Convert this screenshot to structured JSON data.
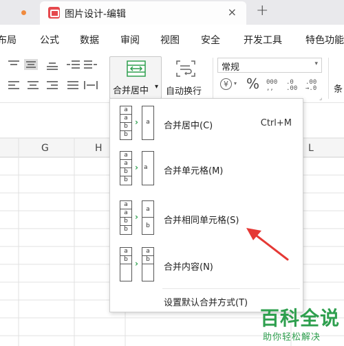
{
  "tabbar": {
    "doc_title": "图片设计-编辑",
    "close_glyph": "×",
    "new_tab_glyph": "+"
  },
  "menubar": {
    "items": [
      "布局",
      "公式",
      "数据",
      "审阅",
      "视图",
      "安全",
      "开发工具",
      "特色功能"
    ]
  },
  "ribbon": {
    "merge_center_label": "合并居中",
    "merge_center_caret": "▾",
    "wrap_text_label": "自动换行",
    "number_format": {
      "value": "常规",
      "caret": "▾"
    },
    "currency_glyph": "¥",
    "currency_caret": "▾",
    "percent_glyph": "%",
    "thousands_top": "000",
    "thousands_bottom": "‚,",
    "dec_inc_top": ".0",
    "dec_inc_bottom": ".00",
    "dec_dec_top": ".00",
    "dec_dec_bottom": "→.0",
    "next_group_label": "条"
  },
  "sheet": {
    "columns": [
      "G",
      "H",
      "L"
    ]
  },
  "merge_menu": {
    "items": [
      {
        "label": "合并居中(C)",
        "shortcut": "Ctrl+M",
        "icon": "merge-center-icon",
        "left_cells": [
          "a",
          "a",
          "b",
          "b"
        ],
        "right_cells": [
          "a"
        ]
      },
      {
        "label": "合并单元格(M)",
        "shortcut": "",
        "icon": "merge-cells-icon",
        "left_cells": [
          "a",
          "a",
          "b",
          "b"
        ],
        "right_cells": [
          "a"
        ]
      },
      {
        "label": "合并相同单元格(S)",
        "shortcut": "",
        "icon": "merge-same-cells-icon",
        "left_cells": [
          "a",
          "a",
          "b",
          "b"
        ],
        "right_cells": [
          "a",
          "b"
        ]
      },
      {
        "label": "合并内容(N)",
        "shortcut": "",
        "icon": "merge-content-icon",
        "left_cells": [
          "a",
          "b",
          ""
        ],
        "right_cells": [
          "a",
          "b"
        ]
      }
    ],
    "default_setting_label": "设置默认合并方式(T)"
  },
  "watermark": {
    "title": "百科全说",
    "subtitle": "助你轻松解决"
  },
  "colors": {
    "accent_green": "#2e9f4e",
    "pointer_red": "#e53935",
    "tab_dot": "#f08a3e",
    "tab_icon": "#e5484d"
  }
}
